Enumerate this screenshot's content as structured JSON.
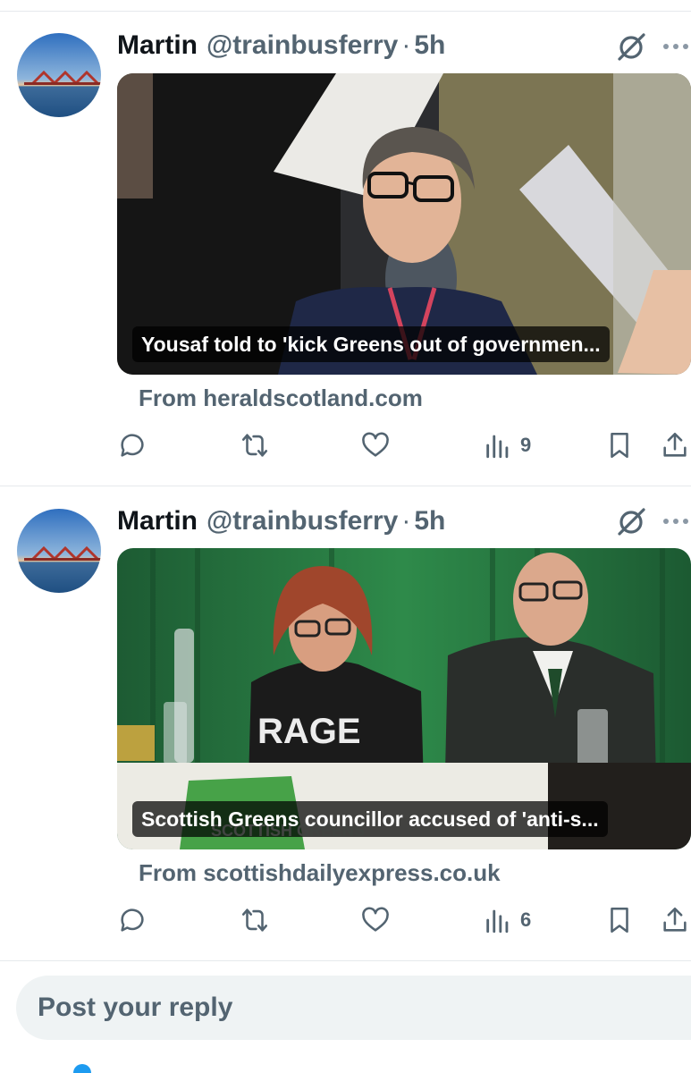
{
  "tweets": [
    {
      "author_name": "Martin",
      "handle": "@trainbusferry",
      "separator": "·",
      "time": "5h",
      "avatar_icon": "forth-bridge-avatar",
      "card_caption": "Yousaf told to 'kick Greens out of governmen...",
      "source": "From heraldscotland.com",
      "views": "9"
    },
    {
      "author_name": "Martin",
      "handle": "@trainbusferry",
      "separator": "·",
      "time": "5h",
      "avatar_icon": "forth-bridge-avatar",
      "card_caption": "Scottish Greens councillor accused of 'anti-s...",
      "source": "From scottishdailyexpress.co.uk",
      "views": "6"
    }
  ],
  "card_image_text": {
    "sign": "RAGE",
    "logo": "SCOTTISH GREENS"
  },
  "icons": {
    "reply": "reply-icon",
    "repost": "repost-icon",
    "like": "like-icon",
    "views": "views-icon",
    "bookmark": "bookmark-icon",
    "share": "share-icon",
    "grok": "grok-icon",
    "more": "more-icon"
  },
  "compose": {
    "placeholder": "Post your reply"
  },
  "colors": {
    "text_primary": "#0f1419",
    "text_secondary": "#536471",
    "divider": "#e6e9ec",
    "input_bg": "#eff3f4",
    "accent": "#1d9bf0"
  }
}
